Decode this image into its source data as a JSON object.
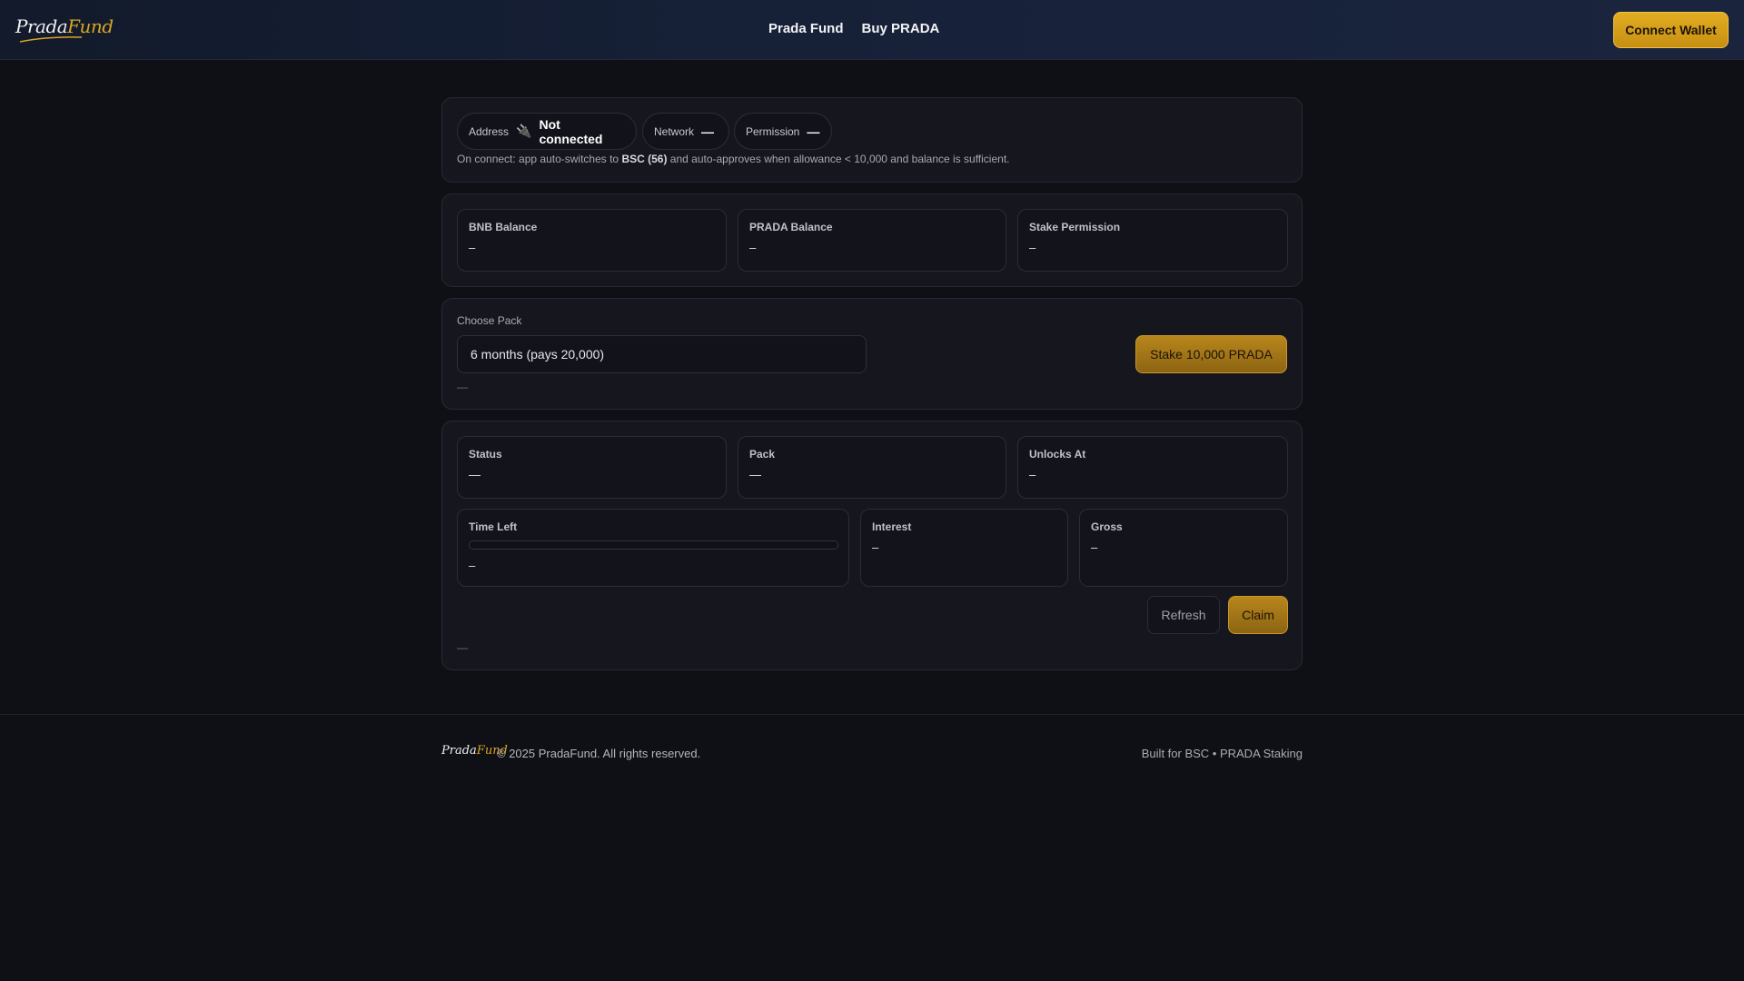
{
  "brand": {
    "logo_main": "Prada",
    "logo_accent": "Fund",
    "accent": "#d9a522"
  },
  "nav": {
    "items": [
      "Prada Fund",
      "Buy PRADA"
    ]
  },
  "header": {
    "connect_label": "Connect Wallet"
  },
  "connection": {
    "address_label": "Address",
    "address_value": "Not connected",
    "address_icon": "plug-icon",
    "network_label": "Network",
    "network_value": "—",
    "permission_label": "Permission",
    "permission_value": "—",
    "note_prefix": "On connect: app auto-switches to ",
    "note_bold": "BSC (56)",
    "note_suffix": " and auto-approves when allowance < 10,000 and balance is sufficient."
  },
  "balances": [
    {
      "label": "BNB Balance",
      "value": "–"
    },
    {
      "label": "PRADA Balance",
      "value": "–"
    },
    {
      "label": "Stake Permission",
      "value": "–"
    }
  ],
  "stake": {
    "choose_label": "Choose Pack",
    "selected_pack": "6 months (pays 20,000)",
    "stake_button": "Stake 10,000 PRADA",
    "status_text": "—"
  },
  "position": {
    "stats": [
      {
        "label": "Status",
        "value": "—"
      },
      {
        "label": "Pack",
        "value": "—"
      },
      {
        "label": "Unlocks At",
        "value": "–"
      }
    ],
    "time_left_label": "Time Left",
    "time_left_value": "–",
    "time_left_progress": 0,
    "interest_label": "Interest",
    "interest_value": "–",
    "gross_label": "Gross",
    "gross_value": "–",
    "refresh_button": "Refresh",
    "claim_button": "Claim",
    "status_text": "—"
  },
  "footer": {
    "copyright": "© 2025 PradaFund. All rights reserved.",
    "tagline": "Built for BSC • PRADA Staking"
  }
}
